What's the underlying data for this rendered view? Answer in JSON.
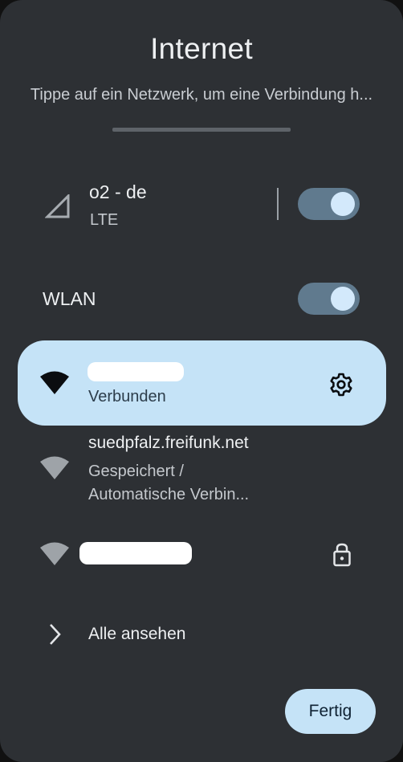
{
  "dialog": {
    "title": "Internet",
    "subtitle": "Tippe auf ein Netzwerk, um eine Verbindung h..."
  },
  "mobile": {
    "name": "o2 - de",
    "type": "LTE",
    "toggle_on": true
  },
  "wlan": {
    "label": "WLAN",
    "toggle_on": true
  },
  "networks": [
    {
      "name": "",
      "status": "Verbunden",
      "icon": "wifi-icon",
      "action_icon": "gear-icon",
      "connected": true
    },
    {
      "name": "suedpfalz.freifunk.net",
      "status_line1": "Gespeichert /",
      "status_line2": "Automatische Verbin...",
      "icon": "wifi-icon"
    },
    {
      "name": "",
      "icon": "wifi-icon",
      "action_icon": "lock-icon"
    }
  ],
  "see_all": {
    "label": "Alle ansehen",
    "icon": "chevron-right-icon"
  },
  "done_button": {
    "label": "Fertig"
  },
  "colors": {
    "panel": "#2d3034",
    "accent_light": "#c5e3f7",
    "toggle_track": "#607a8e",
    "toggle_knob": "#d3e9fb"
  }
}
